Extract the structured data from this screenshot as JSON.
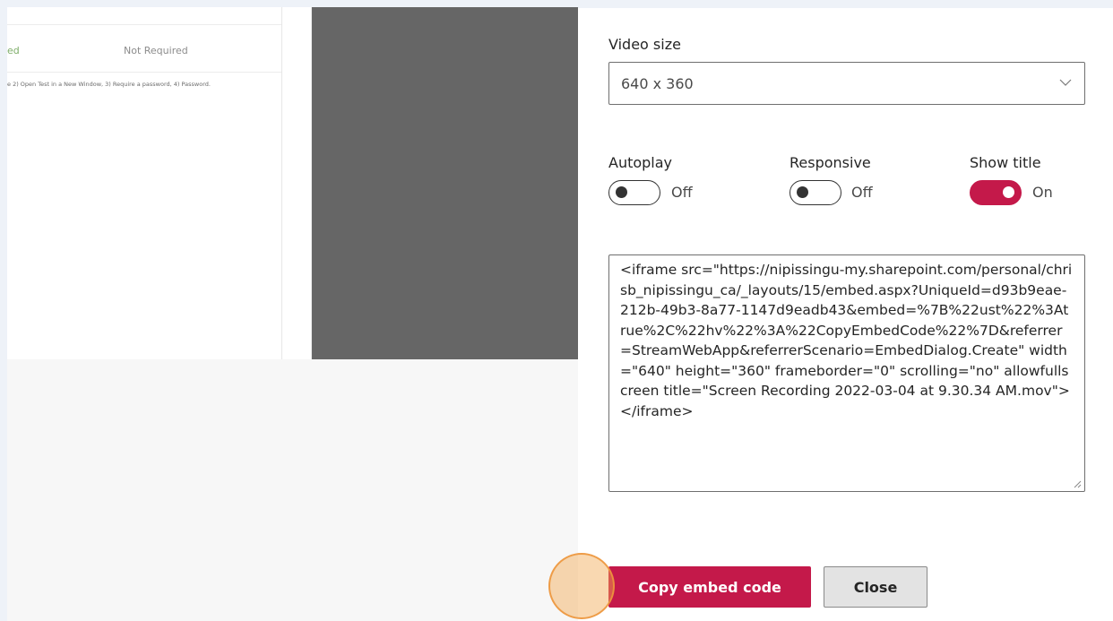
{
  "background": {
    "status_left": "ed",
    "status_right": "Not Required",
    "steps_text": "e 2) Open Test in a New Window, 3) Require a password, 4) Password."
  },
  "dialog": {
    "video_size": {
      "label": "Video size",
      "selected": "640 x 360",
      "icon": "chevron-down-icon"
    },
    "toggles": {
      "autoplay": {
        "label": "Autoplay",
        "state": "Off"
      },
      "responsive": {
        "label": "Responsive",
        "state": "Off"
      },
      "show_title": {
        "label": "Show title",
        "state": "On"
      }
    },
    "embed_code": "<iframe src=\"https://nipissingu-my.sharepoint.com/personal/chrisb_nipissingu_ca/_layouts/15/embed.aspx?UniqueId=d93b9eae-212b-49b3-8a77-1147d9eadb43&embed=%7B%22ust%22%3Atrue%2C%22hv%22%3A%22CopyEmbedCode%22%7D&referrer=StreamWebApp&referrerScenario=EmbedDialog.Create\" width=\"640\" height=\"360\" frameborder=\"0\" scrolling=\"no\" allowfullscreen title=\"Screen Recording 2022-03-04 at 9.30.34 AM.mov\"></iframe>",
    "buttons": {
      "copy": "Copy embed code",
      "close": "Close"
    }
  },
  "colors": {
    "accent": "#c4194a",
    "click_highlight": "#f2a852"
  }
}
